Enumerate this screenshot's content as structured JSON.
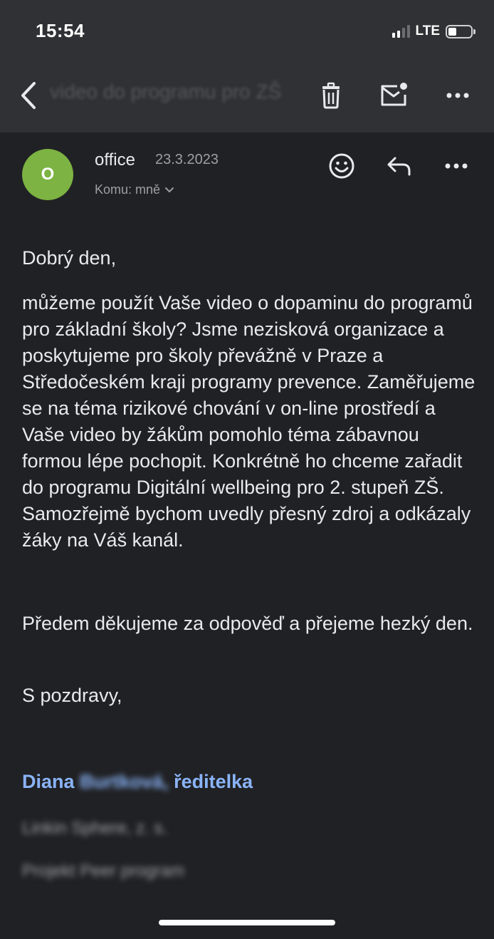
{
  "status_bar": {
    "time": "15:54",
    "network": "LTE",
    "signal_bars": 4,
    "signal_active": 2,
    "battery_level": 0.35
  },
  "toolbar": {
    "subject_preview": "video do programu pro ZŠ",
    "icons": [
      "back-icon",
      "trash-icon",
      "mark-unread-icon",
      "more-icon"
    ]
  },
  "message": {
    "avatar_letter": "O",
    "avatar_color": "#7cb342",
    "sender": "office",
    "date": "23.3.2023",
    "to_label": "Komu: mně",
    "greeting": "Dobrý den,",
    "body": "můžeme použít Vaše video o dopaminu do programů pro základní školy? Jsme nezisková organizace a poskytujeme pro školy převážně v Praze a Středočeském kraji programy prevence. Zaměřujeme se na téma rizikové chování v on-line prostředí a Vaše video by žákům pomohlo téma zábavnou formou lépe pochopit. Konkrétně ho chceme zařadit do programu Digitální wellbeing pro 2. stupeň ZŠ. Samozřejmě bychom uvedly přesný zdroj a odkázaly žáky na Váš kanál.",
    "thanks": "Předem děkujeme za odpověď a přejeme hezký den.",
    "regards": "S pozdravy,",
    "signature_first": "Diana",
    "signature_surname": "Burtková,",
    "signature_role": "ředitelka",
    "signature_org": "Linkin Sphere, z. s.",
    "signature_project": "Projekt Peer program"
  },
  "colors": {
    "background": "#202124",
    "toolbar": "#303134",
    "link": "#8ab4f8"
  }
}
